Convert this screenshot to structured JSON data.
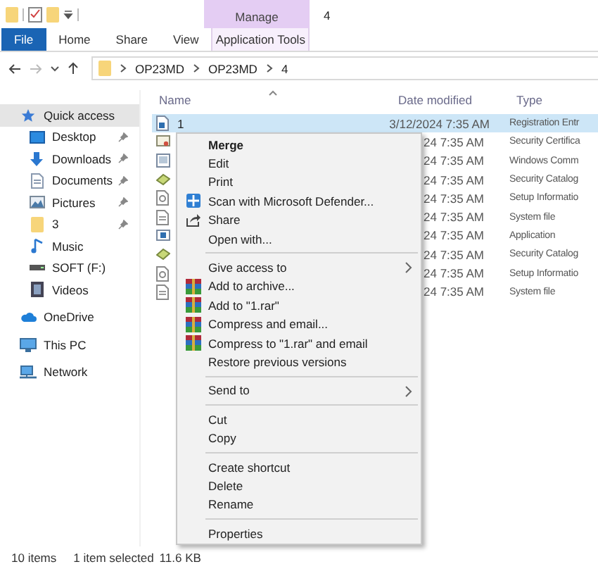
{
  "title_bar": {
    "contextual_tab": "Manage",
    "title": "4"
  },
  "ribbon_tabs": [
    {
      "label": "File",
      "kind": "file"
    },
    {
      "label": "Home",
      "kind": "tab"
    },
    {
      "label": "Share",
      "kind": "tab"
    },
    {
      "label": "View",
      "kind": "tab"
    },
    {
      "label": "Application Tools",
      "kind": "contextual"
    }
  ],
  "address_bar": {
    "path": [
      "OP23MD",
      "OP23MD",
      "4"
    ]
  },
  "sidebar": {
    "items": [
      {
        "label": "Quick access",
        "kind": "star",
        "selected": true,
        "pinned": false,
        "children": [
          {
            "label": "Desktop",
            "kind": "desktop",
            "selected": false,
            "pinned": true
          },
          {
            "label": "Downloads",
            "kind": "downloads",
            "selected": false,
            "pinned": true
          },
          {
            "label": "Documents",
            "kind": "documents",
            "selected": false,
            "pinned": true
          },
          {
            "label": "Pictures",
            "kind": "pictures",
            "selected": false,
            "pinned": true
          },
          {
            "label": "3",
            "kind": "folder",
            "selected": false,
            "pinned": true
          },
          {
            "label": "Music",
            "kind": "music",
            "selected": false,
            "pinned": false
          },
          {
            "label": "SOFT (F:)",
            "kind": "drive",
            "selected": false,
            "pinned": false
          },
          {
            "label": "Videos",
            "kind": "videos",
            "selected": false,
            "pinned": false
          }
        ]
      },
      {
        "label": "OneDrive",
        "kind": "cloud",
        "selected": false,
        "pinned": false
      },
      {
        "label": "This PC",
        "kind": "pc",
        "selected": false,
        "pinned": false
      },
      {
        "label": "Network",
        "kind": "network",
        "selected": false,
        "pinned": false
      }
    ]
  },
  "file_list": {
    "columns": [
      "Name",
      "Date modified",
      "Type"
    ],
    "rows": [
      {
        "name": "1",
        "date": "3/12/2024 7:35 AM",
        "type": "Registration Entr",
        "kind": "reg",
        "selected": true
      },
      {
        "date": "24 7:35 AM",
        "type": "Security Certifica",
        "kind": "cert",
        "selected": false
      },
      {
        "date": "24 7:35 AM",
        "type": "Windows Comm",
        "kind": "cmd",
        "selected": false
      },
      {
        "date": "24 7:35 AM",
        "type": "Security Catalog",
        "kind": "cat",
        "selected": false
      },
      {
        "date": "24 7:35 AM",
        "type": "Setup Informatio",
        "kind": "inf",
        "selected": false
      },
      {
        "date": "24 7:35 AM",
        "type": "System file",
        "kind": "sys",
        "selected": false
      },
      {
        "date": "24 7:35 AM",
        "type": "Application",
        "kind": "app",
        "selected": false
      },
      {
        "date": "24 7:35 AM",
        "type": "Security Catalog",
        "kind": "cat",
        "selected": false
      },
      {
        "date": "24 7:35 AM",
        "type": "Setup Informatio",
        "kind": "inf",
        "selected": false
      },
      {
        "date": "24 7:35 AM",
        "type": "System file",
        "kind": "sys",
        "selected": false
      }
    ]
  },
  "context_menu": {
    "items": [
      {
        "kind": "plain",
        "label": "Merge",
        "default": true,
        "submenu": false
      },
      {
        "kind": "plain",
        "label": "Edit",
        "default": false,
        "submenu": false
      },
      {
        "kind": "plain",
        "label": "Print",
        "default": false,
        "submenu": false
      },
      {
        "kind": "defender",
        "label": "Scan with Microsoft Defender...",
        "default": false,
        "submenu": false
      },
      {
        "kind": "share",
        "label": "Share",
        "default": false,
        "submenu": false
      },
      {
        "kind": "plain",
        "label": "Open with...",
        "default": false,
        "submenu": false
      },
      {
        "kind": "separator"
      },
      {
        "kind": "plain",
        "label": "Give access to",
        "default": false,
        "submenu": true
      },
      {
        "kind": "archive",
        "label": "Add to archive...",
        "default": false,
        "submenu": false
      },
      {
        "kind": "archive",
        "label": "Add to \"1.rar\"",
        "default": false,
        "submenu": false
      },
      {
        "kind": "archive",
        "label": "Compress and email...",
        "default": false,
        "submenu": false
      },
      {
        "kind": "archive",
        "label": "Compress to \"1.rar\" and email",
        "default": false,
        "submenu": false
      },
      {
        "kind": "plain",
        "label": "Restore previous versions",
        "default": false,
        "submenu": false
      },
      {
        "kind": "separator"
      },
      {
        "kind": "plain",
        "label": "Send to",
        "default": false,
        "submenu": true
      },
      {
        "kind": "separator"
      },
      {
        "kind": "plain",
        "label": "Cut",
        "default": false,
        "submenu": false
      },
      {
        "kind": "plain",
        "label": "Copy",
        "default": false,
        "submenu": false
      },
      {
        "kind": "separator"
      },
      {
        "kind": "plain",
        "label": "Create shortcut",
        "default": false,
        "submenu": false
      },
      {
        "kind": "plain",
        "label": "Delete",
        "default": false,
        "submenu": false
      },
      {
        "kind": "plain",
        "label": "Rename",
        "default": false,
        "submenu": false
      },
      {
        "kind": "separator"
      },
      {
        "kind": "plain",
        "label": "Properties",
        "default": false,
        "submenu": false
      }
    ]
  },
  "status_bar": {
    "item_count": "10 items",
    "selection": "1 item selected",
    "size": "11.6 KB"
  }
}
